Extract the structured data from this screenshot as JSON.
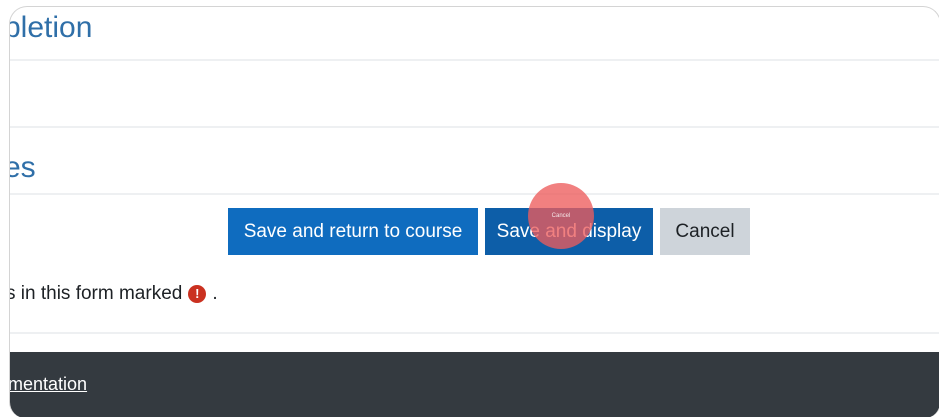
{
  "sections": {
    "top_title": "pletion",
    "middle_title": "es"
  },
  "form_buttons": {
    "save_return_label": "Save and return to course",
    "save_display_label": "Save and display",
    "cancel_label": "Cancel"
  },
  "cursor": {
    "tiny_label": "Cancel"
  },
  "required_note": {
    "text": "s in this form marked",
    "icon": "exclamation-circle-icon",
    "trailing": "."
  },
  "footer": {
    "link_text": "mentation"
  },
  "colors": {
    "primary": "#0f6cbf",
    "primary_active": "#0d5ea8",
    "secondary": "#ced4da",
    "title": "#2f6fa8",
    "danger": "#ca3120",
    "footer_bg": "#343a40",
    "cursor_highlight": "#ed5c5c"
  }
}
